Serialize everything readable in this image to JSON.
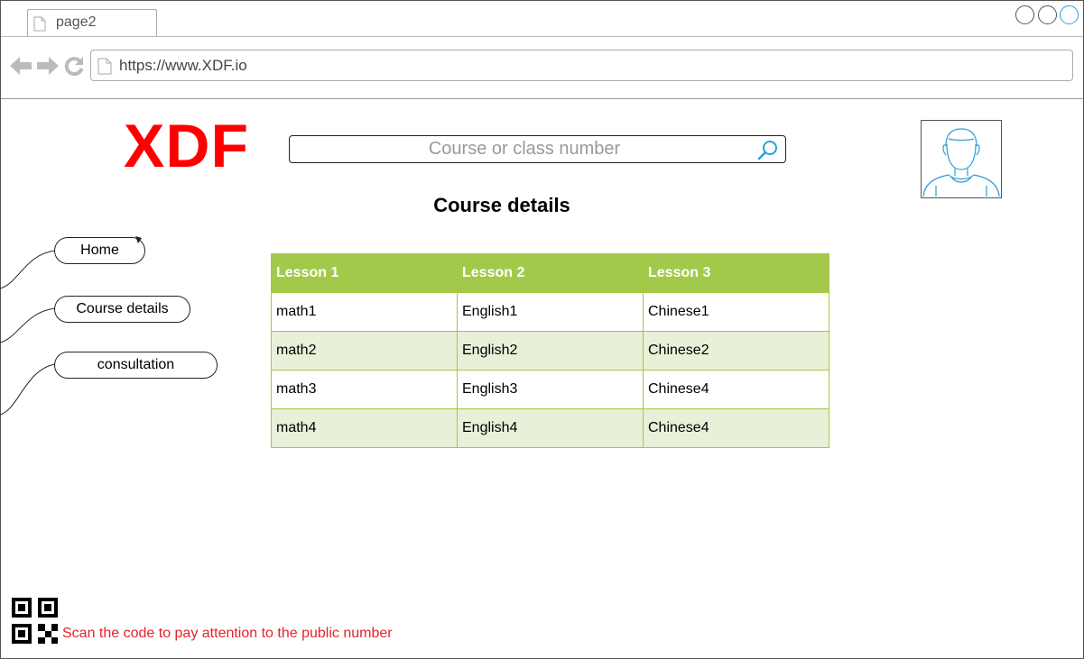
{
  "browser": {
    "tab_title": "page2",
    "url": "https://www.XDF.io"
  },
  "header": {
    "logo_text": "XDF",
    "search_placeholder": "Course or class number"
  },
  "page_title": "Course details",
  "sidebar": {
    "items": [
      {
        "label": "Home"
      },
      {
        "label": "Course details"
      },
      {
        "label": "consultation"
      }
    ]
  },
  "table": {
    "columns": [
      "Lesson 1",
      "Lesson 2",
      "Lesson 3"
    ],
    "rows": [
      [
        "math1",
        "English1",
        "Chinese1"
      ],
      [
        "math2",
        "English2",
        "Chinese2"
      ],
      [
        "math3",
        "English3",
        "Chinese4"
      ],
      [
        "math4",
        "English4",
        "Chinese4"
      ]
    ]
  },
  "footer": {
    "qr_caption": "Scan the code to pay attention to the public number"
  },
  "colors": {
    "logo": "#ff0000",
    "table_header": "#a3c94a",
    "table_alt_row": "#e8f0d8",
    "caption": "#e5232b"
  }
}
